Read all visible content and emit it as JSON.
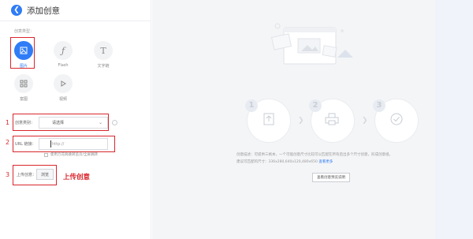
{
  "header": {
    "back_icon": "back-arrow-icon",
    "title": "添加创意"
  },
  "creative_type": {
    "label": "创意类型：",
    "types": [
      {
        "label": "图片",
        "icon": "image-icon",
        "active": true
      },
      {
        "label": "Flash",
        "icon": "flash-icon",
        "active": false
      },
      {
        "label": "文字链",
        "icon": "text-icon",
        "active": false
      },
      {
        "label": "富图",
        "icon": "grid-icon",
        "active": false
      },
      {
        "label": "视频",
        "icon": "play-icon",
        "active": false
      }
    ]
  },
  "annotations": {
    "step1": "1",
    "step2": "2",
    "step3": "3",
    "upload_note": "上传创意"
  },
  "form": {
    "category_label": "创意类别：",
    "category_placeholder": "请选择",
    "url_label": "URL 链接：",
    "url_value": "http://",
    "checkbox_label": "使用万花筒跳转首页/全屏跳转",
    "upload_label": "上传创意：",
    "upload_button": "浏览"
  },
  "preview": {
    "steps": [
      {
        "number": "1",
        "icon": "upload-icon"
      },
      {
        "number": "2",
        "icon": "printer-icon"
      },
      {
        "number": "3",
        "icon": "check-icon"
      }
    ],
    "desc_line1": "创意描述：可提供三格本，一个可能创意尺寸比较可以匹配在所有后出多个尺寸创意，形成创意组。",
    "desc_line2": "建议可匹配的尺寸：336x280,640x120,480x650",
    "desc_link": "查看更多",
    "button": "查看创意预览说明"
  },
  "colors": {
    "accent": "#2f7cf6",
    "annotation_red": "#d9262c",
    "panel_gray": "#f4f5f7"
  }
}
